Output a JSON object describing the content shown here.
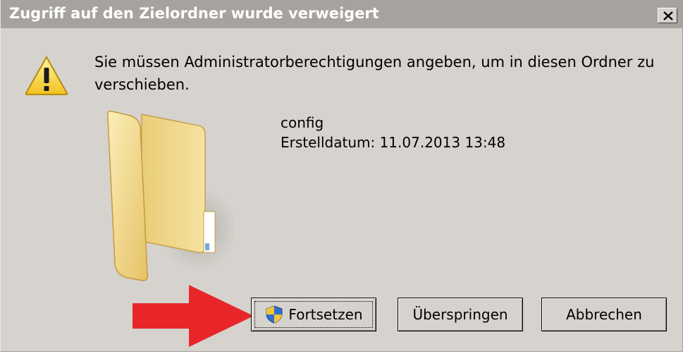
{
  "window": {
    "title": "Zugriff auf den Zielordner wurde verweigert",
    "close_label": "×"
  },
  "message": "Sie müssen Administratorberechtigungen angeben, um in diesen Ordner zu verschieben.",
  "item": {
    "name": "config",
    "created": "Erstelldatum: 11.07.2013 13:48",
    "icon": "folder-icon"
  },
  "buttons": {
    "continue_label": "Fortsetzen",
    "skip_label": "Überspringen",
    "cancel_label": "Abbrechen"
  },
  "icons": {
    "warning": "warning-icon",
    "shield": "uac-shield-icon",
    "annotation": "red-arrow"
  },
  "colors": {
    "titlebar": "#a6a29d",
    "dialog_bg": "#d6d3ce",
    "annotation_arrow": "#e8262a"
  }
}
